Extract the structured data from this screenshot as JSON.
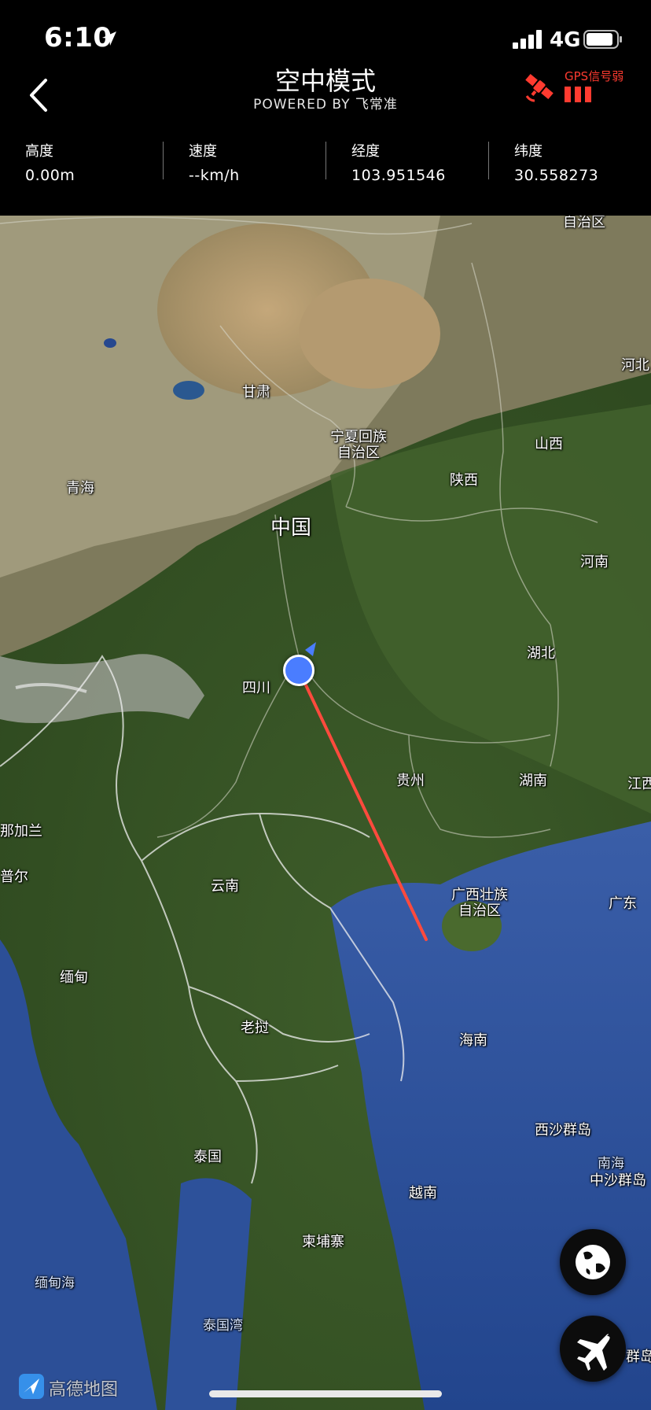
{
  "status_bar": {
    "time": "6:10",
    "network": "4G",
    "icons": [
      "location-arrow-icon",
      "signal-icon",
      "battery-icon"
    ]
  },
  "header": {
    "title": "空中模式",
    "subtitle": "POWERED BY 飞常准",
    "gps_status": "GPS信号弱",
    "back_icon": "chevron-left-icon",
    "gps_icon": "satellite-icon"
  },
  "telemetry": [
    {
      "label": "高度",
      "value": "0.00m"
    },
    {
      "label": "速度",
      "value": "--km/h"
    },
    {
      "label": "经度",
      "value": "103.951546"
    },
    {
      "label": "纬度",
      "value": "30.558273"
    }
  ],
  "map": {
    "places": {
      "autonomous_region_top": "自治区",
      "hebei": "河北",
      "gansu": "甘肃",
      "ningxia": "宁夏回族\n自治区",
      "shanxi": "山西",
      "qinghai": "青海",
      "shaanxi": "陕西",
      "china": "中国",
      "henan": "河南",
      "sichuan": "四川",
      "hubei": "湖北",
      "guizhou": "贵州",
      "hunan": "湖南",
      "jiangxi": "江西",
      "nagaland": "那加兰",
      "manipur": "普尔",
      "yunnan": "云南",
      "guangxi": "广西壮族\n自治区",
      "guangdong": "广东",
      "myanmar": "缅甸",
      "laos": "老挝",
      "hainan": "海南",
      "paracel": "西沙群岛",
      "south_sea": "南海",
      "zhongsha": "中沙群岛",
      "thailand": "泰国",
      "vietnam": "越南",
      "cambodia": "柬埔寨",
      "andaman": "缅甸海",
      "gulf_thailand": "泰国湾",
      "nansha": "南沙群岛"
    },
    "provider": "高德地图",
    "colors": {
      "route": "#ff4a3d",
      "marker": "#4a7dff",
      "land": "#4f6b34",
      "desert": "#b89a6e",
      "sea": "#2d4f9a"
    },
    "buttons": {
      "globe": "globe-icon",
      "flight": "airplane-icon"
    }
  }
}
